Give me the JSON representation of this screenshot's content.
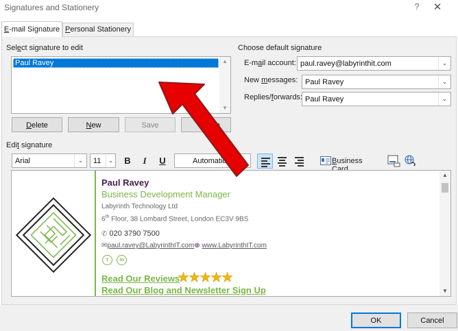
{
  "window": {
    "title": "Signatures and Stationery",
    "help_glyph": "?",
    "close_glyph": "✕"
  },
  "tabs": [
    {
      "accel": "E",
      "rest": "-mail Signature",
      "active": true
    },
    {
      "prefix": "",
      "accel": "P",
      "rest": "ersonal Stationery",
      "active": false
    }
  ],
  "select_section": {
    "label_pre": "Sel",
    "label_accel": "e",
    "label_post": "ct signature to edit",
    "items": [
      "Paul Ravey"
    ]
  },
  "sig_buttons": {
    "delete": {
      "accel": "D",
      "rest": "elete"
    },
    "new": {
      "accel": "N",
      "rest": "ew"
    },
    "save": "Save",
    "rename": "me"
  },
  "default_section": {
    "label": "Choose default signature",
    "email_account_label_pre": "E-m",
    "email_account_label_accel": "a",
    "email_account_label_post": "il account:",
    "email_account_value": "paul.ravey@labyrinthit.com",
    "new_messages_label_pre": "New ",
    "new_messages_label_accel": "m",
    "new_messages_label_post": "essages:",
    "new_messages_value": "Paul Ravey",
    "replies_label_pre": "Replies/",
    "replies_label_accel": "f",
    "replies_label_post": "orwards:",
    "replies_value": "Paul Ravey"
  },
  "edit_section": {
    "label_pre": "Edi",
    "label_accel": "t",
    "label_post": " signature",
    "font": "Arial",
    "size": "11",
    "bold": "B",
    "italic": "I",
    "underline": "U",
    "color": "Automatic",
    "business_card_accel": "B",
    "business_card_rest": "usiness Card"
  },
  "signature": {
    "name": "Paul Ravey",
    "title": "Business Development Manager",
    "company": "Labyrinth Technology Ltd",
    "address_floor": "6",
    "address_sup": "th",
    "address_rest": " Floor, 38 Lombard Street, London EC3V 9BS",
    "phone": "020 3790 7500",
    "email": "paul.ravey@LabyrinthIT.com",
    "website": "www.LabyrinthIT.com",
    "social_twitter": "t",
    "social_linkedin": "in",
    "reviews": "Read Our Reviews",
    "stars": "★★★★★",
    "blog": "Read Our Blog and Newsletter Sign Up"
  },
  "footer": {
    "ok": "OK",
    "cancel": "Cancel"
  },
  "colors": {
    "accent": "#0078d7",
    "brand_green": "#7ab648",
    "brand_purple": "#4a1c4f",
    "arrow_red": "#e60000"
  }
}
